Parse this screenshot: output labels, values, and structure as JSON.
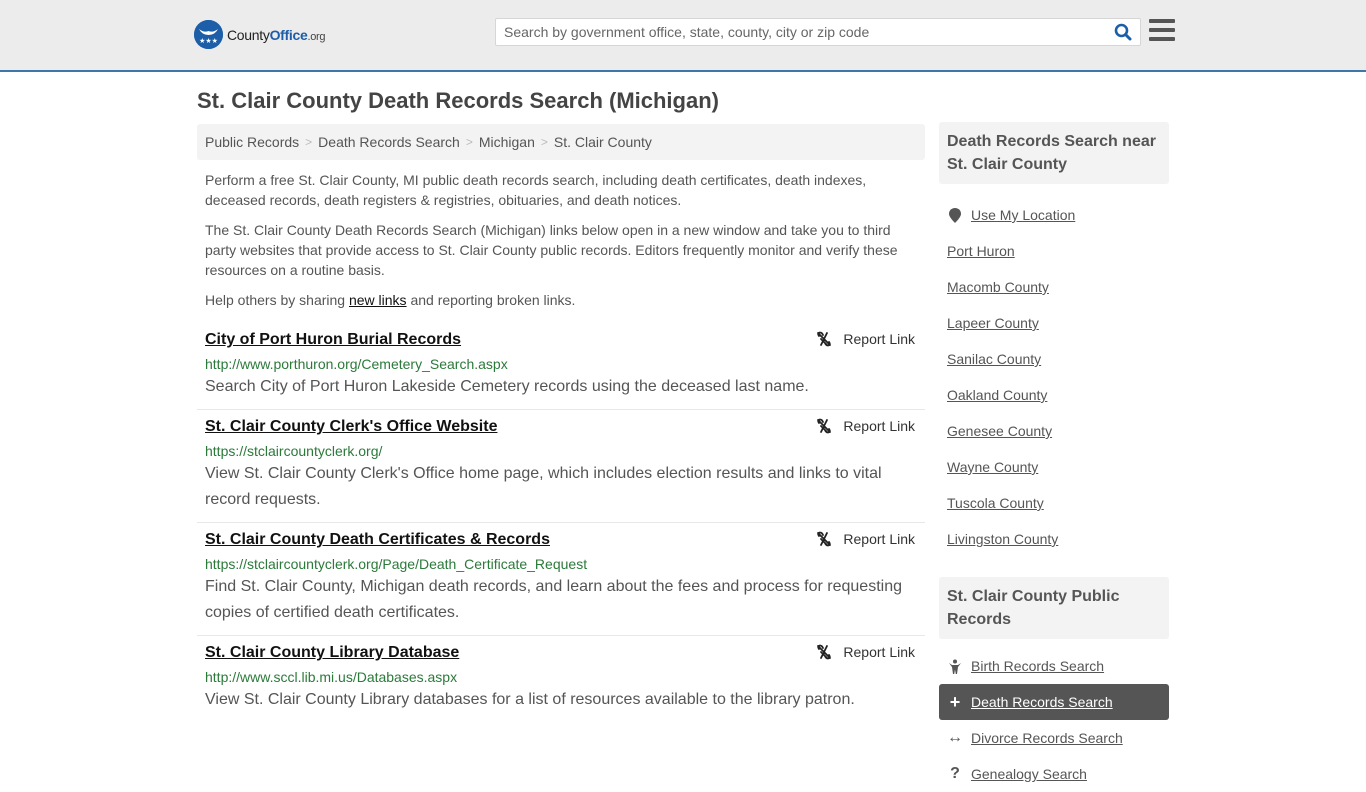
{
  "header": {
    "logo": {
      "name": "County",
      "name_accent": "Office",
      "tld": ".org"
    },
    "search": {
      "placeholder": "Search by government office, state, county, city or zip code",
      "value": ""
    },
    "icons": {
      "search": "search-icon",
      "menu": "hamburger-menu-icon"
    }
  },
  "page": {
    "title": "St. Clair County Death Records Search (Michigan)"
  },
  "breadcrumb": [
    {
      "label": "Public Records"
    },
    {
      "label": "Death Records Search"
    },
    {
      "label": "Michigan"
    },
    {
      "label": "St. Clair County"
    }
  ],
  "breadcrumb_separator": ">",
  "intro": {
    "p1": "Perform a free St. Clair County, MI public death records search, including death certificates, death indexes, deceased records, death registers & registries, obituaries, and death notices.",
    "p2": "The St. Clair County Death Records Search (Michigan) links below open in a new window and take you to third party websites that provide access to St. Clair County public records. Editors frequently monitor and verify these resources on a routine basis.",
    "p3_before": "Help others by sharing ",
    "p3_link": "new links",
    "p3_after": " and reporting broken links."
  },
  "results": [
    {
      "title": "City of Port Huron Burial Records",
      "url": "http://www.porthuron.org/Cemetery_Search.aspx",
      "description": "Search City of Port Huron Lakeside Cemetery records using the deceased last name.",
      "report_label": "Report Link"
    },
    {
      "title": "St. Clair County Clerk's Office Website",
      "url": "https://stclaircountyclerk.org/",
      "description": "View St. Clair County Clerk's Office home page, which includes election results and links to vital record requests.",
      "report_label": "Report Link"
    },
    {
      "title": "St. Clair County Death Certificates & Records",
      "url": "https://stclaircountyclerk.org/Page/Death_Certificate_Request",
      "description": "Find St. Clair County, Michigan death records, and learn about the fees and process for requesting copies of certified death certificates.",
      "report_label": "Report Link"
    },
    {
      "title": "St. Clair County Library Database",
      "url": "http://www.sccl.lib.mi.us/Databases.aspx",
      "description": "View St. Clair County Library databases for a list of resources available to the library patron.",
      "report_label": "Report Link"
    }
  ],
  "sidebar": {
    "nearby_heading": "Death Records Search near St. Clair County",
    "nearby": [
      {
        "label": "Use My Location",
        "icon": "map-pin-icon"
      },
      {
        "label": "Port Huron"
      },
      {
        "label": "Macomb County"
      },
      {
        "label": "Lapeer County"
      },
      {
        "label": "Sanilac County"
      },
      {
        "label": "Oakland County"
      },
      {
        "label": "Genesee County"
      },
      {
        "label": "Wayne County"
      },
      {
        "label": "Tuscola County"
      },
      {
        "label": "Livingston County"
      }
    ],
    "public_records_heading": "St. Clair County Public Records",
    "public_records": [
      {
        "label": "Birth Records Search",
        "icon": "baby-icon",
        "glyph": "Y",
        "active": false
      },
      {
        "label": "Death Records Search",
        "icon": "plus-icon",
        "glyph": "+",
        "active": true
      },
      {
        "label": "Divorce Records Search",
        "icon": "arrows-horizontal-icon",
        "glyph": "↔",
        "active": false
      },
      {
        "label": "Genealogy Search",
        "icon": "question-icon",
        "glyph": "?",
        "active": false
      }
    ]
  },
  "colors": {
    "header_bg": "#ececec",
    "header_border": "#3d78a8",
    "brand_blue": "#1c5ea8",
    "url_green": "#2b7a3a",
    "active_item_bg": "#555555"
  }
}
